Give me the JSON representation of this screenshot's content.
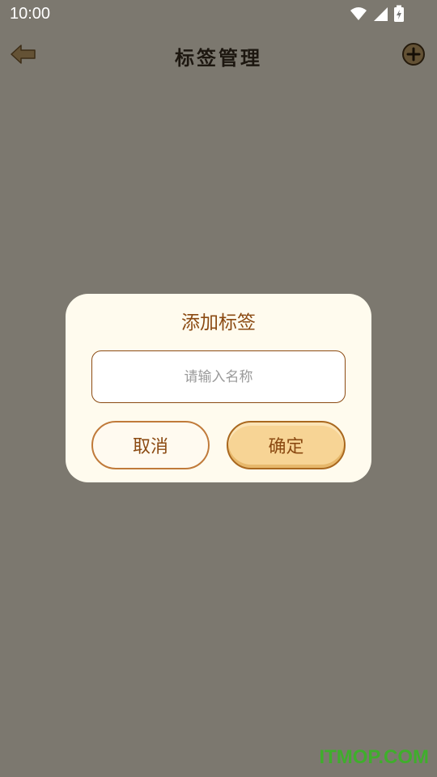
{
  "status_bar": {
    "time": "10:00",
    "icons": [
      "wifi-icon",
      "signal-icon",
      "battery-charging-icon"
    ]
  },
  "app_bar": {
    "title": "标签管理",
    "back_icon": "back-arrow-icon",
    "add_icon": "plus-circle-icon"
  },
  "dialog": {
    "title": "添加标签",
    "input_value": "",
    "input_placeholder": "请输入名称",
    "cancel_label": "取消",
    "confirm_label": "确定"
  },
  "watermark": "ITMOP.COM",
  "colors": {
    "page_background": "#f8f1df",
    "dialog_background": "#fffbee",
    "accent_brown": "#8b4a12",
    "confirm_fill": "#f7d495",
    "watermark_green": "#3fae2c"
  }
}
